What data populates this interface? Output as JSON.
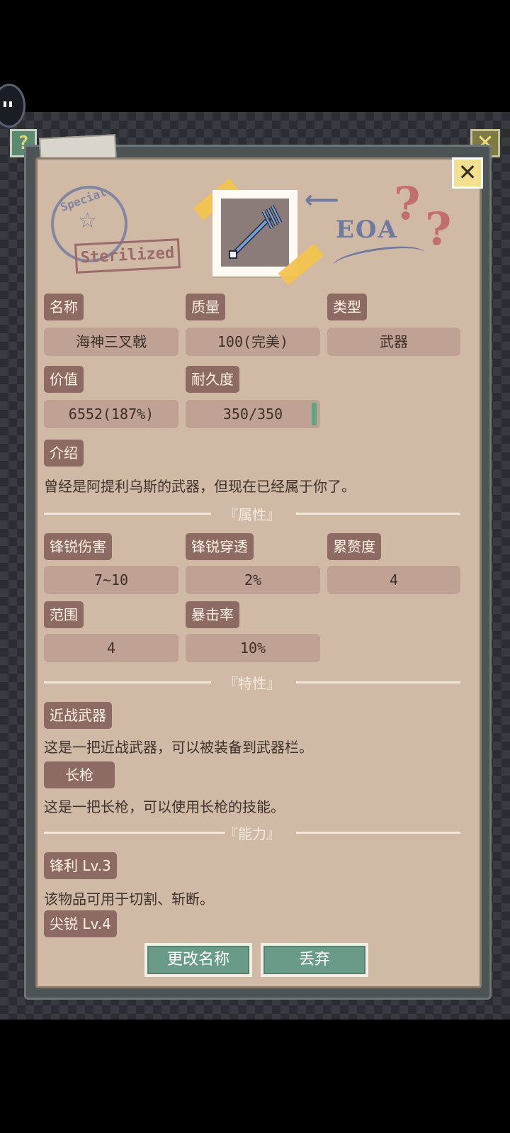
{
  "window": {
    "close_glyph": "✕",
    "help_glyph": "?"
  },
  "decor": {
    "stamp_text": "Special",
    "stamp_label": "Sterilized",
    "eoa_text": "EOA",
    "question_marks": [
      "?",
      "?"
    ]
  },
  "item": {
    "icon": "trident-icon"
  },
  "info": {
    "name_label": "名称",
    "name_value": "海神三叉戟",
    "quality_label": "质量",
    "quality_value": "100(完美)",
    "type_label": "类型",
    "type_value": "武器",
    "price_label": "价值",
    "price_value": "6552(187%)",
    "durability_label": "耐久度",
    "durability_value": "350/350",
    "intro_label": "介绍",
    "intro_text": "曾经是阿提利乌斯的武器，但现在已经属于你了。"
  },
  "attributes": {
    "heading": "『属性』",
    "sharp_damage_label": "锋锐伤害",
    "sharp_damage_value": "7~10",
    "sharp_pierce_label": "锋锐穿透",
    "sharp_pierce_value": "2%",
    "encumbrance_label": "累赘度",
    "encumbrance_value": "4",
    "range_label": "范围",
    "range_value": "4",
    "crit_label": "暴击率",
    "crit_value": "10%"
  },
  "traits": {
    "heading": "『特性』",
    "melee_label": "近战武器",
    "melee_desc": "这是一把近战武器，可以被装备到武器栏。",
    "spear_label": "长枪",
    "spear_desc": "这是一把长枪，可以使用长枪的技能。"
  },
  "abilities": {
    "heading": "『能力』",
    "sharp_label": "锋利 Lv.3",
    "sharp_desc": "该物品可用于切割、斩断。",
    "pointed_label": "尖锐 Lv.4"
  },
  "actions": {
    "rename_label": "更改名称",
    "discard_label": "丢弃"
  }
}
